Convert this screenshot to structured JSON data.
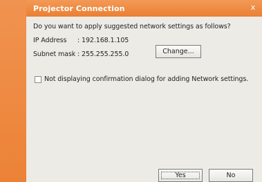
{
  "dialog": {
    "title": "Projector Connection",
    "close_glyph": "x",
    "question": "Do you want to apply suggested network settings as follows?",
    "ip_label": "IP Address",
    "ip_value": ": 192.168.1.105",
    "subnet_label": "Subnet mask",
    "subnet_value": ": 255.255.255.0",
    "change_label": "Change...",
    "checkbox_label": "Not displaying confirmation dialog for adding Network settings.",
    "checkbox_checked": false,
    "yes_label": "Yes",
    "no_label": "No"
  },
  "colors": {
    "frame_accent": "#ee8a3f",
    "panel_background": "#ecebe6",
    "title_text": "#ffffff"
  },
  "icons": {
    "close": "close-icon"
  }
}
